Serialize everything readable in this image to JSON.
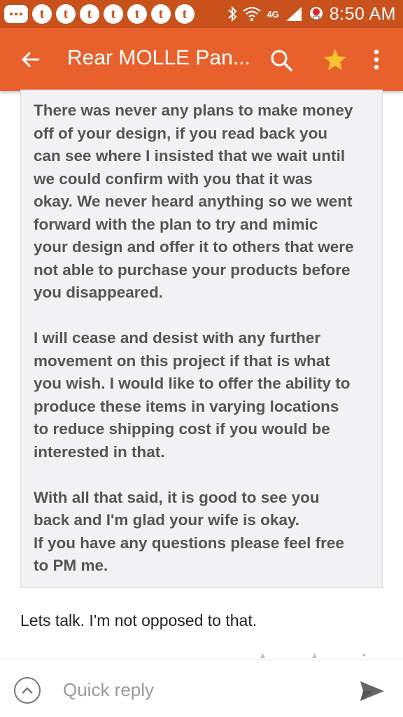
{
  "status_bar": {
    "time": "8:50 AM",
    "network": "4G",
    "notification_icons": [
      "messages-icon",
      "tumblr-icon",
      "tumblr-icon",
      "tumblr-icon",
      "tumblr-icon",
      "tumblr-icon",
      "tumblr-icon",
      "tumblr-icon"
    ],
    "tumblr_letter": "t"
  },
  "app_bar": {
    "title": "Rear MOLLE Pan...",
    "back_icon": "arrow-left-icon",
    "search_icon": "search-icon",
    "star_icon": "star-icon",
    "more_icon": "more-vert-icon",
    "colors": {
      "bar": "#e8612c",
      "status": "#c8511c",
      "star": "#f9c232"
    }
  },
  "quote": {
    "paragraphs": [
      [
        "There was never any plans to make money",
        "off of your design, if you read back you",
        "can see where I insisted that we wait until",
        "we could confirm with you that it was",
        "okay. We never heard anything so we went",
        "forward with the plan to try and mimic",
        "your design and offer it to others that were",
        "not able to purchase your products before",
        "you disappeared."
      ],
      [
        "I will cease and desist with any further",
        "movement on this project if that is what",
        "you wish. I would like to offer the ability to",
        "produce these items in varying locations",
        "to reduce shipping cost if you would be",
        "interested in that."
      ],
      [
        "With all that said, it is good to see you",
        "back and I'm glad your wife is okay.",
        "If you have any questions please feel free",
        "to PM me."
      ]
    ]
  },
  "reply": {
    "text": "Lets talk. I'm not opposed to that."
  },
  "bottom_bar": {
    "placeholder": "Quick reply",
    "expand_icon": "chevron-up-icon",
    "send_icon": "send-icon"
  }
}
